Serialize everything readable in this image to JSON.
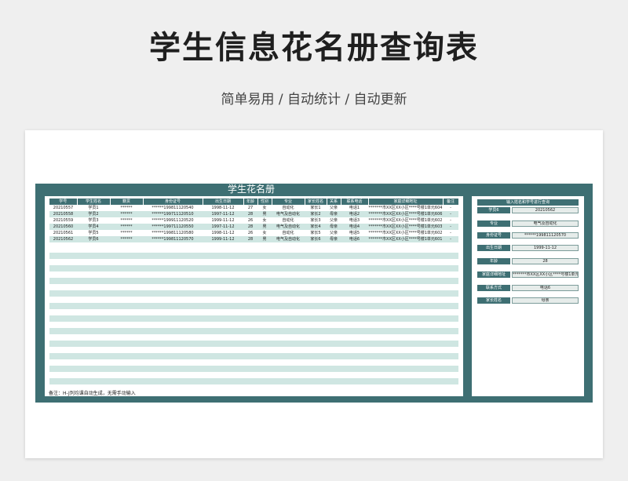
{
  "page": {
    "title": "学生信息花名册查询表",
    "subtitle": "简单易用 / 自动统计 / 自动更新"
  },
  "sheet": {
    "title": "学生花名册",
    "columns": [
      "学号",
      "学生姓名",
      "籍贯",
      "身份证号",
      "出生日期",
      "年龄",
      "性别",
      "专业",
      "家长姓名",
      "关系",
      "联系电话",
      "家庭详细地址",
      "备注"
    ],
    "rows": [
      [
        "20210557",
        "学员1",
        "******",
        "******199811120540",
        "1998-11-12",
        "27",
        "女",
        "自动化",
        "家长1",
        "父亲",
        "电话1",
        "*******市XX区XX小区****号楼1单元604",
        "-"
      ],
      [
        "20210558",
        "学员2",
        "******",
        "******199711120510",
        "1997-11-12",
        "28",
        "男",
        "电气及自动化",
        "家长2",
        "母亲",
        "电话2",
        "*******市XX区XX小区****号楼1单元606",
        "-"
      ],
      [
        "20210559",
        "学员3",
        "******",
        "******199911120520",
        "1999-11-12",
        "26",
        "女",
        "自动化",
        "家长3",
        "父亲",
        "电话3",
        "*******市XX区XX小区****号楼1单元602",
        "-"
      ],
      [
        "20210560",
        "学员4",
        "******",
        "******199711120550",
        "1997-11-12",
        "28",
        "男",
        "电气及自动化",
        "家长4",
        "母亲",
        "电话4",
        "*******市XX区XX小区****号楼1单元603",
        "-"
      ],
      [
        "20210561",
        "学员5",
        "******",
        "******199811120580",
        "1998-11-12",
        "26",
        "女",
        "自动化",
        "家长5",
        "父亲",
        "电话5",
        "*******市XX区XX小区****号楼1单元602",
        "-"
      ],
      [
        "20210562",
        "学员6",
        "******",
        "******199811120570",
        "1999-11-12",
        "28",
        "男",
        "电气及自动化",
        "家长6",
        "母亲",
        "电话6",
        "*******市XX区XX小区****号楼1单元601",
        "-"
      ]
    ],
    "note": "备注：H-J列均课自动生成，无需手动输入"
  },
  "query": {
    "header": "输入姓名和学号进行查询",
    "fields": [
      {
        "label": "学员6",
        "value": "20210562"
      },
      {
        "label": "专业",
        "value": "电气及自动化"
      },
      {
        "label": "身份证号",
        "value": "******199811120570"
      },
      {
        "label": "出生日期",
        "value": "1999-11-12"
      },
      {
        "label": "年龄",
        "value": "28"
      },
      {
        "label": "家庭详细地址",
        "value": "*******市XX区XX小区****号楼1单元601"
      },
      {
        "label": "联系方式",
        "value": "电话6"
      },
      {
        "label": "家长姓名",
        "value": "母亲"
      }
    ]
  },
  "colors": {
    "header_teal": "#3e6f73",
    "stripe": "#cfe6e2",
    "page_bg": "#efefef"
  }
}
